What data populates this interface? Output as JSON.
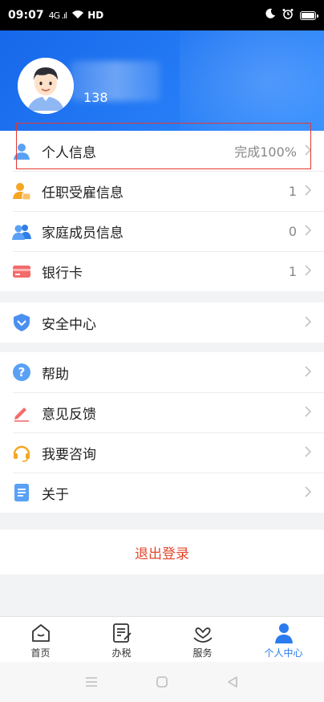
{
  "status_bar": {
    "time": "09:07",
    "signal": "4G .ıl",
    "network": "HD"
  },
  "profile": {
    "phone_prefix": "138"
  },
  "menu_group_1": [
    {
      "label": "个人信息",
      "value": "完成100%",
      "icon": "user-icon"
    },
    {
      "label": "任职受雇信息",
      "value": "1",
      "icon": "employee-icon"
    },
    {
      "label": "家庭成员信息",
      "value": "0",
      "icon": "family-icon"
    },
    {
      "label": "银行卡",
      "value": "1",
      "icon": "bank-card-icon"
    }
  ],
  "menu_group_2": [
    {
      "label": "安全中心",
      "icon": "shield-icon"
    }
  ],
  "menu_group_3": [
    {
      "label": "帮助",
      "icon": "help-icon"
    },
    {
      "label": "意见反馈",
      "icon": "pencil-icon"
    },
    {
      "label": "我要咨询",
      "icon": "headset-icon"
    },
    {
      "label": "关于",
      "icon": "document-icon"
    }
  ],
  "logout_label": "退出登录",
  "tabs": [
    {
      "label": "首页",
      "icon": "home-icon"
    },
    {
      "label": "办税",
      "icon": "tax-form-icon"
    },
    {
      "label": "服务",
      "icon": "heart-hand-icon"
    },
    {
      "label": "个人中心",
      "icon": "person-icon",
      "active": true
    }
  ],
  "colors": {
    "primary": "#2b7bf0",
    "logout": "#e4472c",
    "highlight": "#e53935"
  }
}
